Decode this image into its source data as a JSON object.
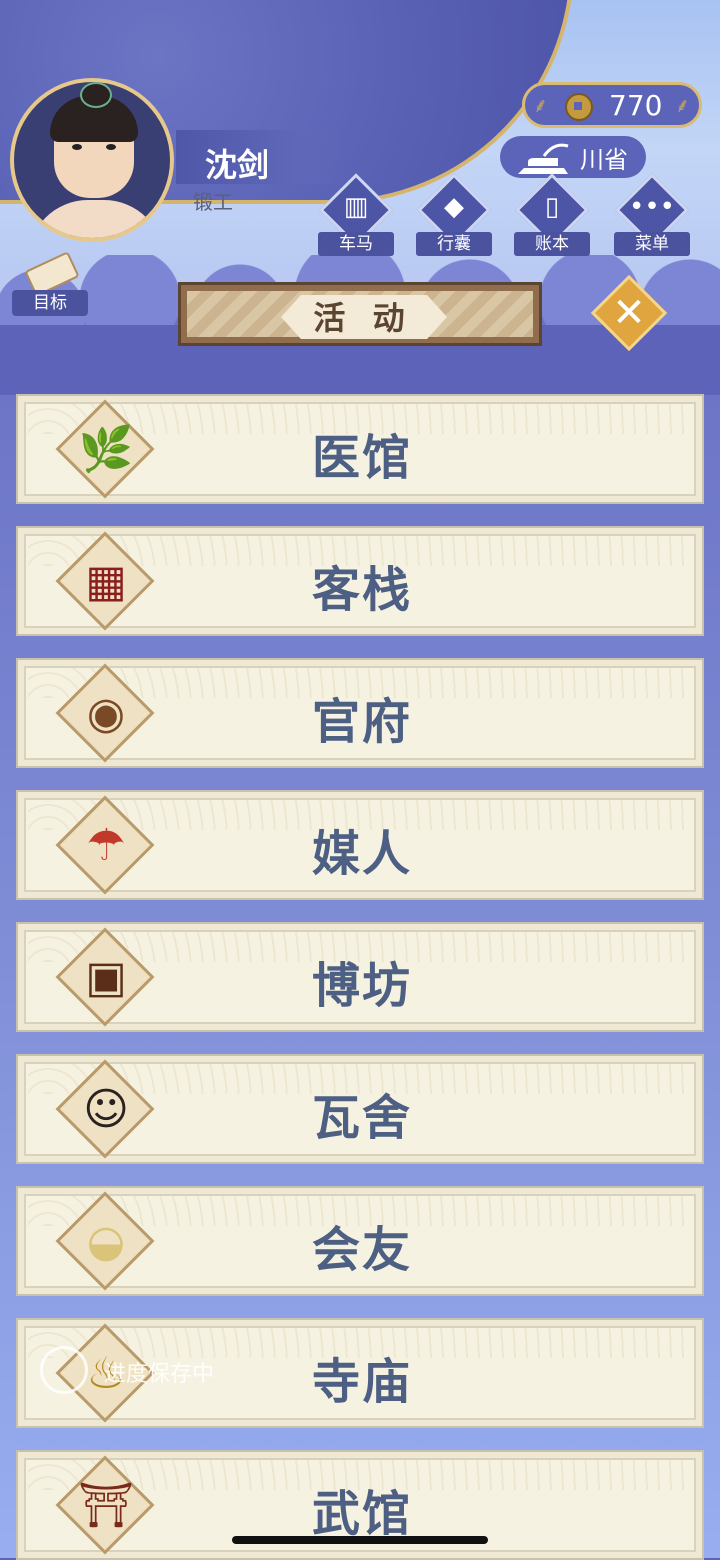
{
  "player": {
    "name": "沈剑",
    "profession": "锻工"
  },
  "currency": {
    "value": "770",
    "icon": "copper-coin-icon"
  },
  "region": {
    "label": "川省",
    "icon": "iron-anvil-icon"
  },
  "nav": [
    {
      "label": "车马",
      "icon": "carriage-icon"
    },
    {
      "label": "行囊",
      "icon": "bundle-icon"
    },
    {
      "label": "账本",
      "icon": "ledger-icon"
    },
    {
      "label": "菜单",
      "icon": "more-icon"
    }
  ],
  "goal": {
    "label": "目标",
    "icon": "scroll-icon"
  },
  "panel": {
    "title": "活 动"
  },
  "activities": [
    {
      "label": "医馆",
      "icon": "ginseng-icon"
    },
    {
      "label": "客栈",
      "icon": "lattice-door-icon"
    },
    {
      "label": "官府",
      "icon": "drum-icon"
    },
    {
      "label": "媒人",
      "icon": "umbrella-icon"
    },
    {
      "label": "博坊",
      "icon": "gambling-box-icon"
    },
    {
      "label": "瓦舍",
      "icon": "performer-icon"
    },
    {
      "label": "会友",
      "icon": "tea-bowls-icon"
    },
    {
      "label": "寺庙",
      "icon": "incense-burner-icon"
    },
    {
      "label": "武馆",
      "icon": "training-gate-icon"
    }
  ],
  "toast": {
    "text": "进度保存中"
  },
  "colors": {
    "accent": "#d9bb72",
    "label_text": "#4d5f82",
    "card_bg": "#f6f2e1"
  }
}
